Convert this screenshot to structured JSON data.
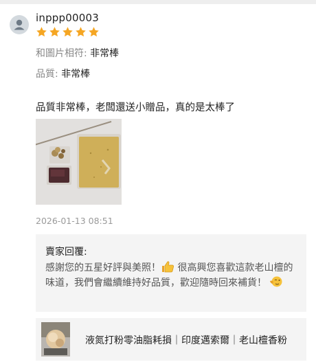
{
  "review": {
    "username": "inppp00003",
    "rating": 5,
    "attributes": [
      {
        "label": "和圖片相符: ",
        "value": "非常棒"
      },
      {
        "label": "品質: ",
        "value": "非常棒"
      }
    ],
    "text": "品質非常棒，老闆還送小贈品，真的是太棒了",
    "date": "2026-01-13 08:51"
  },
  "seller_reply": {
    "title": "賣家回覆:",
    "part1": "感謝您的五星好評與美照！",
    "emoji1": "thumbs-up-emoji",
    "part2": " 很高興您喜歡這款老山檀的味道，我們會繼續維持好品質，歡迎隨時回來補貨！",
    "emoji2": "wink-emoji"
  },
  "product": {
    "title": "液氮打粉零油脂耗損｜印度邁索爾｜老山檀香粉"
  },
  "colors": {
    "star": "#f5a623",
    "reply_bg": "#f4f4f4",
    "secondary_text": "#888888"
  }
}
